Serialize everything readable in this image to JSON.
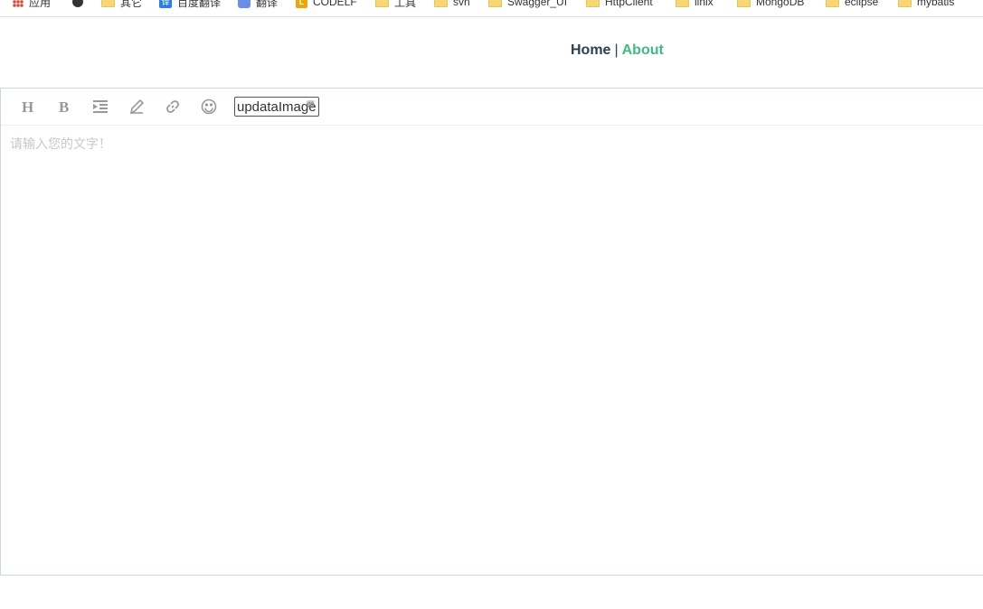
{
  "bookmarks": [
    {
      "label": "应用",
      "icon": "apps-icon"
    },
    {
      "label": "",
      "icon": "moon-icon"
    },
    {
      "label": "其它",
      "icon": "folder-icon"
    },
    {
      "label": "百度翻译",
      "icon": "fanyi-icon"
    },
    {
      "label": "翻译",
      "icon": "translate-icon"
    },
    {
      "label": "CODELF",
      "icon": "codelf-icon"
    },
    {
      "label": "工具",
      "icon": "folder-icon"
    },
    {
      "label": "svn",
      "icon": "folder-icon"
    },
    {
      "label": "Swagger_UI",
      "icon": "folder-icon"
    },
    {
      "label": "HttpClient",
      "icon": "folder-icon"
    },
    {
      "label": "linix",
      "icon": "folder-icon"
    },
    {
      "label": "MongoDB",
      "icon": "folder-icon"
    },
    {
      "label": "eclipse",
      "icon": "folder-icon"
    },
    {
      "label": "mybatis",
      "icon": "folder-icon"
    }
  ],
  "nav": {
    "home": "Home",
    "separator": "|",
    "about": "About"
  },
  "toolbar": {
    "buttons": [
      {
        "name": "heading",
        "glyph": "H"
      },
      {
        "name": "bold",
        "glyph": "B"
      },
      {
        "name": "indent",
        "glyph": ""
      },
      {
        "name": "pen",
        "glyph": ""
      },
      {
        "name": "link",
        "glyph": ""
      },
      {
        "name": "emoji",
        "glyph": ""
      }
    ],
    "upload_label": "updataImage"
  },
  "editor": {
    "placeholder": "请输入您的文字！"
  },
  "colors": {
    "about": "#42b983",
    "home": "#2c3e50",
    "border": "#c9d8db",
    "placeholder": "#c8c8c8"
  }
}
